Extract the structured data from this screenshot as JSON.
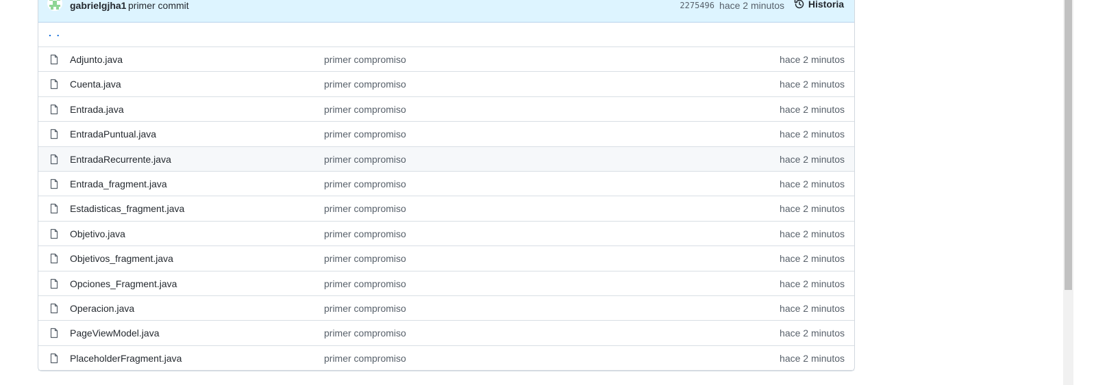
{
  "commit": {
    "author": "gabrielgjha1",
    "message": "primer commit",
    "sha": "2275496",
    "time": "hace 2 minutos",
    "history_label": "Historia"
  },
  "parent_link": ". .",
  "icons": {
    "file": "file-icon",
    "history": "history-icon",
    "avatar": "avatar-icon"
  },
  "colors": {
    "accent": "#0969da",
    "commit_bar_bg": "#ddf4ff",
    "avatar": "#8fd694"
  },
  "files": [
    {
      "name": "Adjunto.java",
      "message": "primer compromiso",
      "time": "hace 2 minutos"
    },
    {
      "name": "Cuenta.java",
      "message": "primer compromiso",
      "time": "hace 2 minutos"
    },
    {
      "name": "Entrada.java",
      "message": "primer compromiso",
      "time": "hace 2 minutos"
    },
    {
      "name": "EntradaPuntual.java",
      "message": "primer compromiso",
      "time": "hace 2 minutos"
    },
    {
      "name": "EntradaRecurrente.java",
      "message": "primer compromiso",
      "time": "hace 2 minutos"
    },
    {
      "name": "Entrada_fragment.java",
      "message": "primer compromiso",
      "time": "hace 2 minutos"
    },
    {
      "name": "Estadisticas_fragment.java",
      "message": "primer compromiso",
      "time": "hace 2 minutos"
    },
    {
      "name": "Objetivo.java",
      "message": "primer compromiso",
      "time": "hace 2 minutos"
    },
    {
      "name": "Objetivos_fragment.java",
      "message": "primer compromiso",
      "time": "hace 2 minutos"
    },
    {
      "name": "Opciones_Fragment.java",
      "message": "primer compromiso",
      "time": "hace 2 minutos"
    },
    {
      "name": "Operacion.java",
      "message": "primer compromiso",
      "time": "hace 2 minutos"
    },
    {
      "name": "PageViewModel.java",
      "message": "primer compromiso",
      "time": "hace 2 minutos"
    },
    {
      "name": "PlaceholderFragment.java",
      "message": "primer compromiso",
      "time": "hace 2 minutos"
    }
  ]
}
